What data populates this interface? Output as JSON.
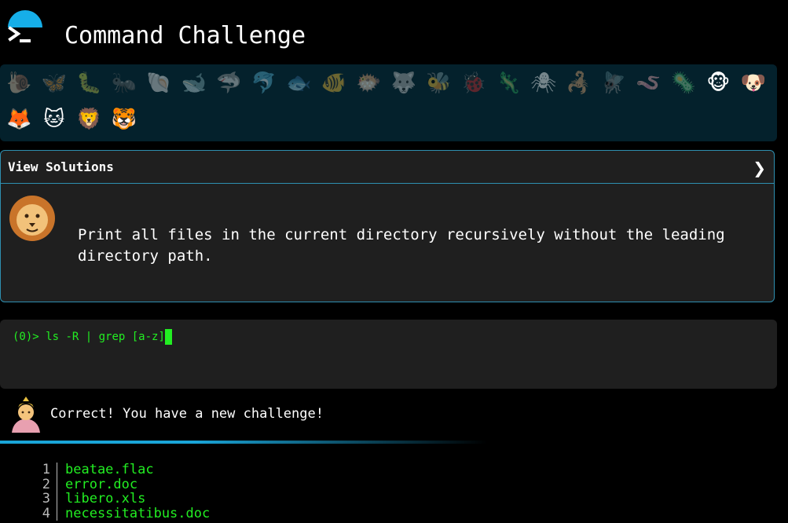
{
  "app": {
    "title": "Command Challenge",
    "icon": "terminal-prompt-icon"
  },
  "colors": {
    "accent": "#16aee8",
    "panel": "#04212c",
    "box_border": "#2e8fb0",
    "terminal_text": "#22ee22"
  },
  "animals": [
    {
      "name": "snail-icon",
      "glyph": "🐌",
      "dim": true
    },
    {
      "name": "butterfly-icon",
      "glyph": "🦋",
      "dim": true
    },
    {
      "name": "caterpillar-icon",
      "glyph": "🐛",
      "dim": true
    },
    {
      "name": "ant-icon",
      "glyph": "🐜",
      "dim": true
    },
    {
      "name": "shell-icon",
      "glyph": "🐚",
      "dim": true
    },
    {
      "name": "whale-icon",
      "glyph": "🐋",
      "dim": true
    },
    {
      "name": "shark-icon",
      "glyph": "🦈",
      "dim": true
    },
    {
      "name": "dolphin-icon",
      "glyph": "🐬",
      "dim": true
    },
    {
      "name": "fish-icon",
      "glyph": "🐟",
      "dim": true
    },
    {
      "name": "tropical-fish-icon",
      "glyph": "🐠",
      "dim": true
    },
    {
      "name": "blowfish-icon",
      "glyph": "🐡",
      "dim": true
    },
    {
      "name": "wolf-icon",
      "glyph": "🐺",
      "dim": true
    },
    {
      "name": "bee-icon",
      "glyph": "🐝",
      "dim": true
    },
    {
      "name": "ladybug-icon",
      "glyph": "🐞",
      "dim": true
    },
    {
      "name": "lizard-icon",
      "glyph": "🦎",
      "dim": true
    },
    {
      "name": "spider-icon",
      "glyph": "🕷",
      "dim": true
    },
    {
      "name": "scorpion-icon",
      "glyph": "🦂",
      "dim": true
    },
    {
      "name": "fly-icon",
      "glyph": "🪰",
      "dim": true
    },
    {
      "name": "worm-icon",
      "glyph": "🪱",
      "dim": true
    },
    {
      "name": "microbe-icon",
      "glyph": "🦠",
      "dim": true
    },
    {
      "name": "monkey-icon",
      "glyph": "🐵",
      "dim": false
    },
    {
      "name": "dog-icon",
      "glyph": "🐶",
      "dim": false
    },
    {
      "name": "fox-icon",
      "glyph": "🦊",
      "dim": false
    },
    {
      "name": "cat-icon",
      "glyph": "🐱",
      "dim": false
    },
    {
      "name": "lion-icon",
      "glyph": "🦁",
      "dim": false
    },
    {
      "name": "tiger-icon",
      "glyph": "🐯",
      "dim": false
    }
  ],
  "solutions": {
    "label": "View Solutions",
    "chevron": "❯"
  },
  "challenge": {
    "avatar_icon": "lion-icon",
    "text": "Print all files in the current directory recursively without the leading directory path."
  },
  "terminal": {
    "prompt": "(0)> ",
    "command": "ls -R | grep [a-z]"
  },
  "feedback": {
    "avatar_icon": "genie-icon",
    "text": "Correct! You have a new challenge!"
  },
  "output": [
    {
      "n": "1",
      "text": "beatae.flac"
    },
    {
      "n": "2",
      "text": "error.doc"
    },
    {
      "n": "3",
      "text": "libero.xls"
    },
    {
      "n": "4",
      "text": "necessitatibus.doc"
    }
  ]
}
